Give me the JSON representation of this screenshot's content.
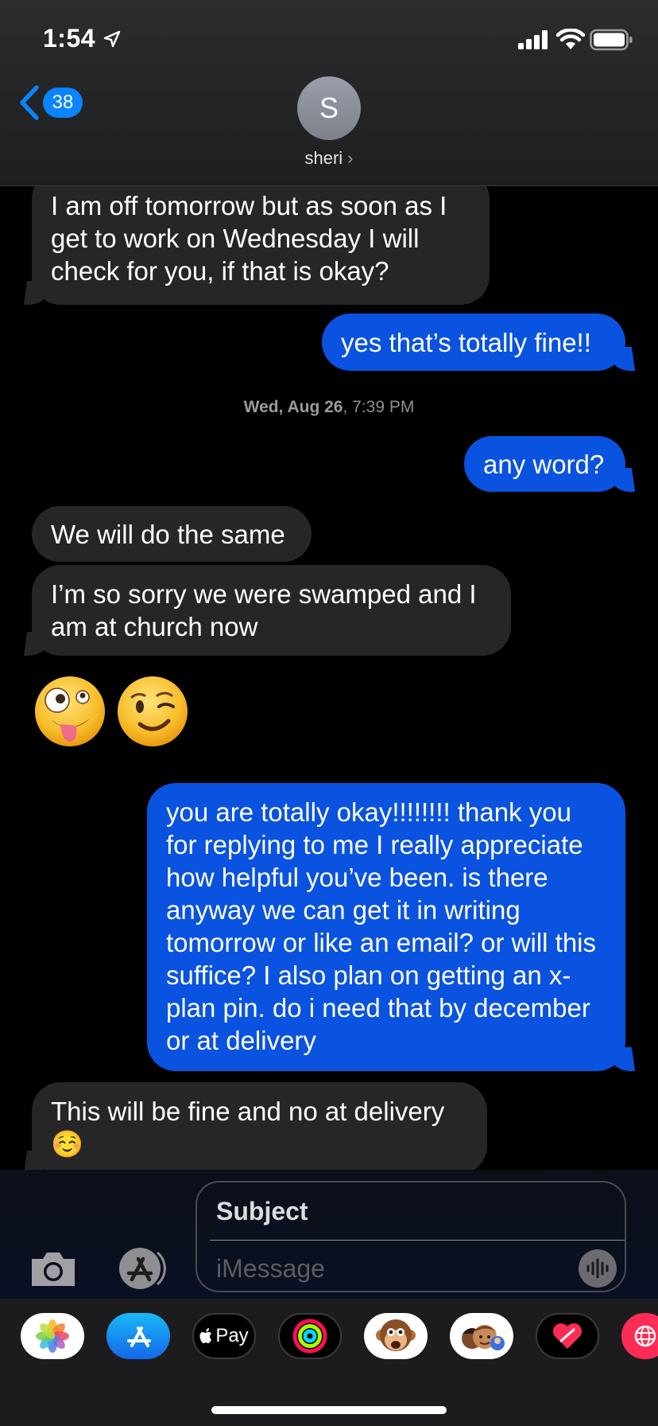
{
  "status_bar": {
    "time": "1:54"
  },
  "header": {
    "back_badge": "38",
    "avatar_initial": "S",
    "contact_name": "sheri",
    "contact_chevron": "›"
  },
  "messages": [
    {
      "direction": "received",
      "text": "I am off tomorrow but as soon as I get to work on Wednesday I will check for you, if that is okay?"
    },
    {
      "direction": "sent",
      "text": "yes that’s totally fine!!"
    },
    {
      "direction": "sent",
      "text": "any word?"
    },
    {
      "direction": "received",
      "text": "We will do the same"
    },
    {
      "direction": "received",
      "text": "I’m so sorry we were swamped and I am at church now"
    },
    {
      "direction": "received",
      "text": "🤪 😉"
    },
    {
      "direction": "sent",
      "text": "you are totally okay!!!!!!!! thank you for replying to me I really appreciate how helpful you’ve been. is there anyway we can get it in writing tomorrow or like an email? or will this suffice? I also plan on getting an x-plan pin. do i need that by december or at delivery"
    },
    {
      "direction": "received",
      "text": "This will be fine and no at delivery ☺️"
    }
  ],
  "timestamp": {
    "day": "Wed, Aug 26",
    "time": ", 7:39 PM"
  },
  "compose": {
    "subject_placeholder": "Subject",
    "message_placeholder": "iMessage"
  },
  "app_drawer": {
    "apps": [
      {
        "name": "photos-app",
        "icon": "photos-icon"
      },
      {
        "name": "app-store-app",
        "icon": "app-store-icon"
      },
      {
        "name": "apple-pay-app",
        "icon": "apple-pay-icon",
        "label": "Pay"
      },
      {
        "name": "activity-app",
        "icon": "activity-rings-icon"
      },
      {
        "name": "animoji-app",
        "icon": "monkey-animoji-icon"
      },
      {
        "name": "memoji-app",
        "icon": "memoji-icon"
      },
      {
        "name": "digital-touch-app",
        "icon": "heart-touch-icon"
      },
      {
        "name": "web-search-app",
        "icon": "globe-icon"
      }
    ]
  },
  "colors": {
    "sent_bubble": "#0a53e0",
    "received_bubble": "#262628",
    "accent": "#0a84ff"
  }
}
